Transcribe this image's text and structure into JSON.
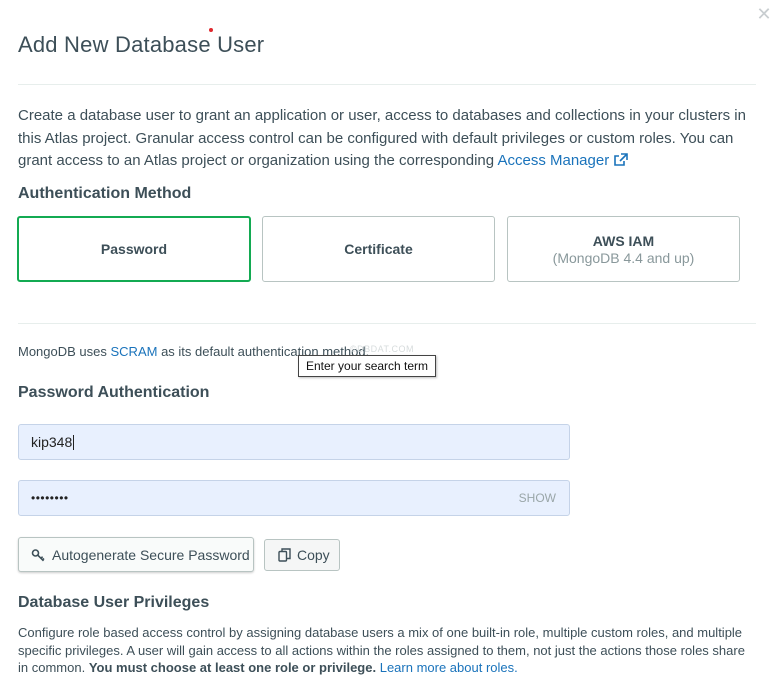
{
  "dialog": {
    "title": "Add New Database User",
    "close_icon": "close-icon"
  },
  "intro": {
    "text": "Create a database user to grant an application or user, access to databases and collections in your clusters in this Atlas project. Granular access control can be configured with default privileges or custom roles. You can grant access to an Atlas project or organization using the corresponding ",
    "link": "Access Manager"
  },
  "auth_method": {
    "heading": "Authentication Method",
    "options": [
      {
        "label": "Password",
        "sublabel": "",
        "selected": true
      },
      {
        "label": "Certificate",
        "sublabel": "",
        "selected": false
      },
      {
        "label": "AWS IAM",
        "sublabel": "(MongoDB 4.4 and up)",
        "selected": false
      }
    ]
  },
  "scram": {
    "prefix": "MongoDB uses ",
    "link": "SCRAM",
    "suffix": " as its default authentication method."
  },
  "watermark": "©DBDAT.COM",
  "tooltip": "Enter your search term",
  "password_auth": {
    "heading": "Password Authentication",
    "username_value": "kip348",
    "password_mask": "••••••••",
    "show_label": "SHOW",
    "autogenerate_label": "Autogenerate Secure Password",
    "copy_label": "Copy"
  },
  "privileges": {
    "heading": "Database User Privileges",
    "text": "Configure role based access control by assigning database users a mix of one built-in role, multiple custom roles, and multiple specific privileges. A user will gain access to all actions within the roles assigned to them, not just the actions those roles share in common. ",
    "bold": "You must choose at least one role or privilege.",
    "link": "Learn more about roles."
  },
  "colors": {
    "accent_green": "#13aa52",
    "link_blue": "#1a73bb",
    "field_bg": "#e8f0fe"
  }
}
